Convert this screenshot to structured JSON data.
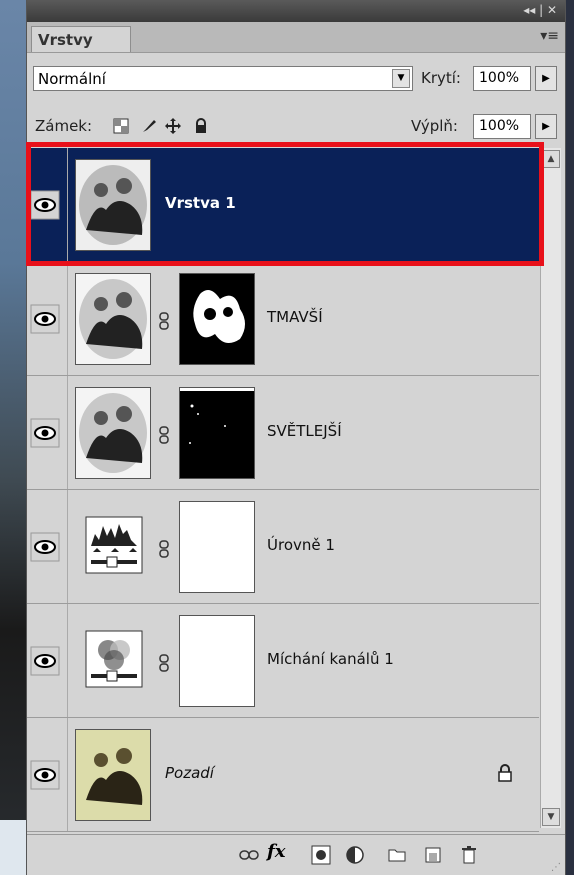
{
  "window": {
    "controls": "◂◂ | ✕"
  },
  "panel": {
    "tab_label": "Vrstvy",
    "menu_icon": "panel-menu-icon"
  },
  "blend": {
    "mode": "Normální",
    "opacity_label": "Krytí:",
    "opacity_value": "100%"
  },
  "lock": {
    "label": "Zámek:",
    "fill_label": "Výplň:",
    "fill_value": "100%"
  },
  "layers": [
    {
      "name": "Vrstva 1",
      "selected": true,
      "thumbnail": "photo-bw",
      "mask": null
    },
    {
      "name": "TMAVŠÍ",
      "selected": false,
      "thumbnail": "photo-bw",
      "mask": "mask-dark"
    },
    {
      "name": "SVĚTLEJŠÍ",
      "selected": false,
      "thumbnail": "photo-bw",
      "mask": "mask-light"
    },
    {
      "name": "Úrovně 1",
      "selected": false,
      "thumbnail": "levels-icon",
      "mask": "mask-white"
    },
    {
      "name": "Míchání kanálů 1",
      "selected": false,
      "thumbnail": "channel-mixer-icon",
      "mask": "mask-white"
    },
    {
      "name": "Pozadí",
      "selected": false,
      "thumbnail": "photo-sepia",
      "mask": null,
      "locked": true
    }
  ],
  "colors": {
    "selected_row": "#0a2158",
    "highlight_border": "#e8101a",
    "panel_bg": "#d4d4d4"
  }
}
